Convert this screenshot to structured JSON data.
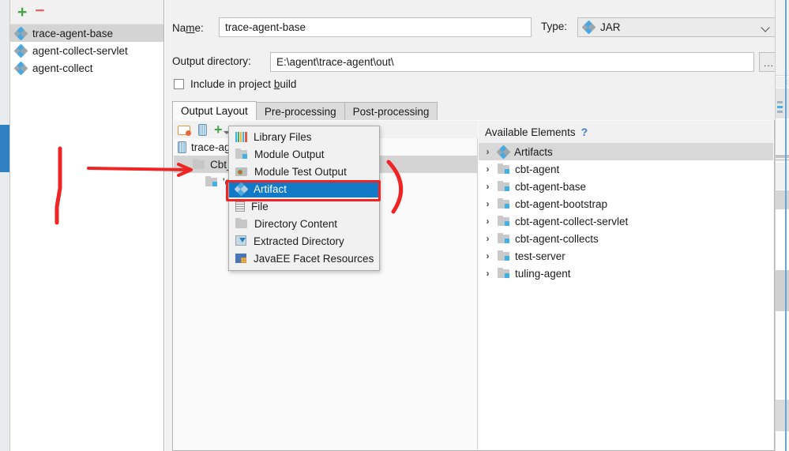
{
  "left_panel": {
    "toolbar": {
      "add_label": "+",
      "remove_label": "−"
    },
    "items": [
      {
        "label": "trace-agent-base",
        "icon": "artifact-icon",
        "selected": true
      },
      {
        "label": "agent-collect-servlet",
        "icon": "artifact-icon",
        "selected": false
      },
      {
        "label": "agent-collect",
        "icon": "artifact-icon",
        "selected": false
      }
    ]
  },
  "detail": {
    "name_label": "Name:",
    "name_value": "trace-agent-base",
    "type_label": "Type:",
    "type_value": "JAR",
    "type_icon": "artifact-icon",
    "output_dir_label": "Output directory:",
    "output_dir_value": "E:\\agent\\trace-agent\\out\\",
    "browse_label": "...",
    "include_in_build_label": "Include in project build",
    "include_in_build_checked": false,
    "tabs": [
      {
        "label": "Output Layout",
        "active": true
      },
      {
        "label": "Pre-processing",
        "active": false
      },
      {
        "label": "Post-processing",
        "active": false
      }
    ]
  },
  "output_layout": {
    "toolbar_icons": [
      "folder-gear-icon",
      "jar-icon",
      "add-dropdown-icon"
    ],
    "tree": [
      {
        "label": "trace-age",
        "icon": "jar-icon",
        "indent": 0,
        "selected": false
      },
      {
        "label": "Cbt_co",
        "icon": "folder-icon",
        "indent": 1,
        "selected": true
      },
      {
        "label": "'cbt-ag",
        "icon": "module-folder-icon",
        "indent": 2,
        "selected": false
      }
    ]
  },
  "available_elements": {
    "title": "Available Elements",
    "help_label": "?",
    "items": [
      {
        "label": "Artifacts",
        "icon": "artifact-icon",
        "caret": "›",
        "selected": true
      },
      {
        "label": "cbt-agent",
        "icon": "module-folder-icon",
        "caret": "›",
        "selected": false
      },
      {
        "label": "cbt-agent-base",
        "icon": "module-folder-icon",
        "caret": "›",
        "selected": false
      },
      {
        "label": "cbt-agent-bootstrap",
        "icon": "module-folder-icon",
        "caret": "›",
        "selected": false
      },
      {
        "label": "cbt-agent-collect-servlet",
        "icon": "module-folder-icon",
        "caret": "›",
        "selected": false
      },
      {
        "label": "cbt-agent-collects",
        "icon": "module-folder-icon",
        "caret": "›",
        "selected": false
      },
      {
        "label": "test-server",
        "icon": "module-folder-icon",
        "caret": "›",
        "selected": false
      },
      {
        "label": "tuling-agent",
        "icon": "module-folder-icon",
        "caret": "›",
        "selected": false
      }
    ]
  },
  "popup_menu": {
    "items": [
      {
        "label": "Library Files",
        "icon": "library-files-icon",
        "active": false
      },
      {
        "label": "Module Output",
        "icon": "module-output-icon",
        "active": false
      },
      {
        "label": "Module Test Output",
        "icon": "module-test-output-icon",
        "active": false
      },
      {
        "label": "Artifact",
        "icon": "artifact-icon",
        "active": true
      },
      {
        "label": "File",
        "icon": "file-icon",
        "active": false
      },
      {
        "label": "Directory Content",
        "icon": "directory-icon",
        "active": false
      },
      {
        "label": "Extracted Directory",
        "icon": "extracted-directory-icon",
        "active": false
      },
      {
        "label": "JavaEE Facet Resources",
        "icon": "javaee-facet-icon",
        "active": false
      }
    ]
  },
  "annotations": {
    "color": "#ef2525",
    "shapes": [
      "left-vertical-stroke",
      "horizontal-arrow-to-tree-row",
      "highlight-rectangle-artifact",
      "right-curly-brace"
    ]
  },
  "colors": {
    "selection_blue": "#1279c6",
    "annotation_red": "#ef2525",
    "row_selected_gray": "#d4d4d4",
    "panel_bg": "#f1f1f1",
    "scrollbar_blue": "#2f7fc1"
  }
}
